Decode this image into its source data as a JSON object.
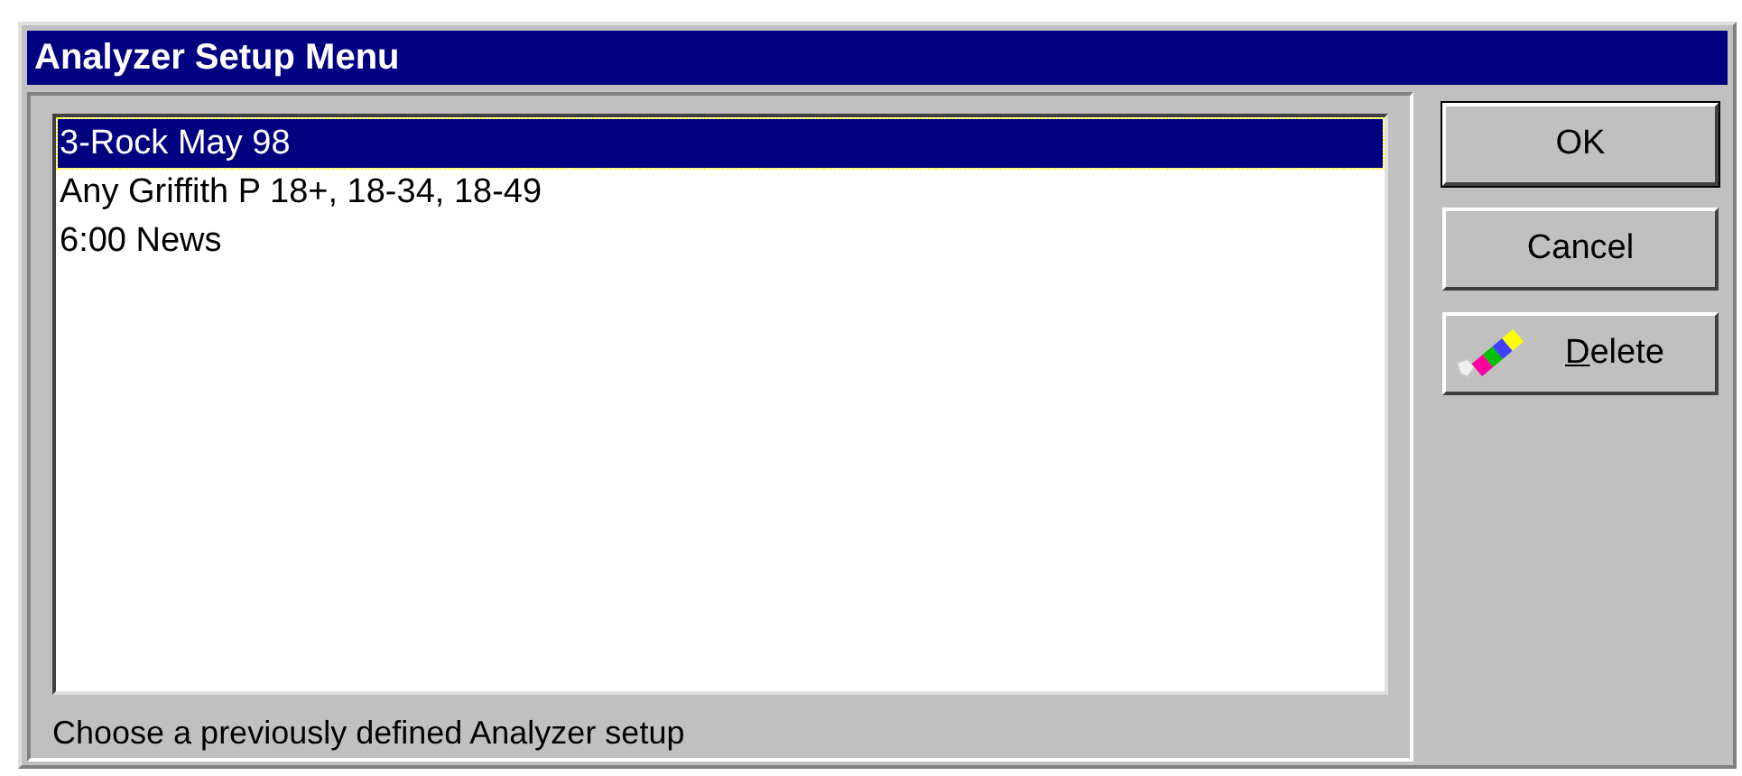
{
  "window": {
    "title": "Analyzer Setup Menu"
  },
  "list": {
    "items": [
      {
        "label": "3-Rock May 98",
        "selected": true
      },
      {
        "label": "Any Griffith P 18+, 18-34, 18-49",
        "selected": false
      },
      {
        "label": "6:00 News",
        "selected": false
      }
    ]
  },
  "hint": "Choose a previously defined Analyzer setup",
  "buttons": [
    {
      "label": "OK",
      "kind": "default",
      "underline_first": false
    },
    {
      "label": "Cancel",
      "kind": "plain",
      "underline_first": false
    },
    {
      "label": "Delete",
      "kind": "eraser",
      "underline_first": true
    }
  ]
}
